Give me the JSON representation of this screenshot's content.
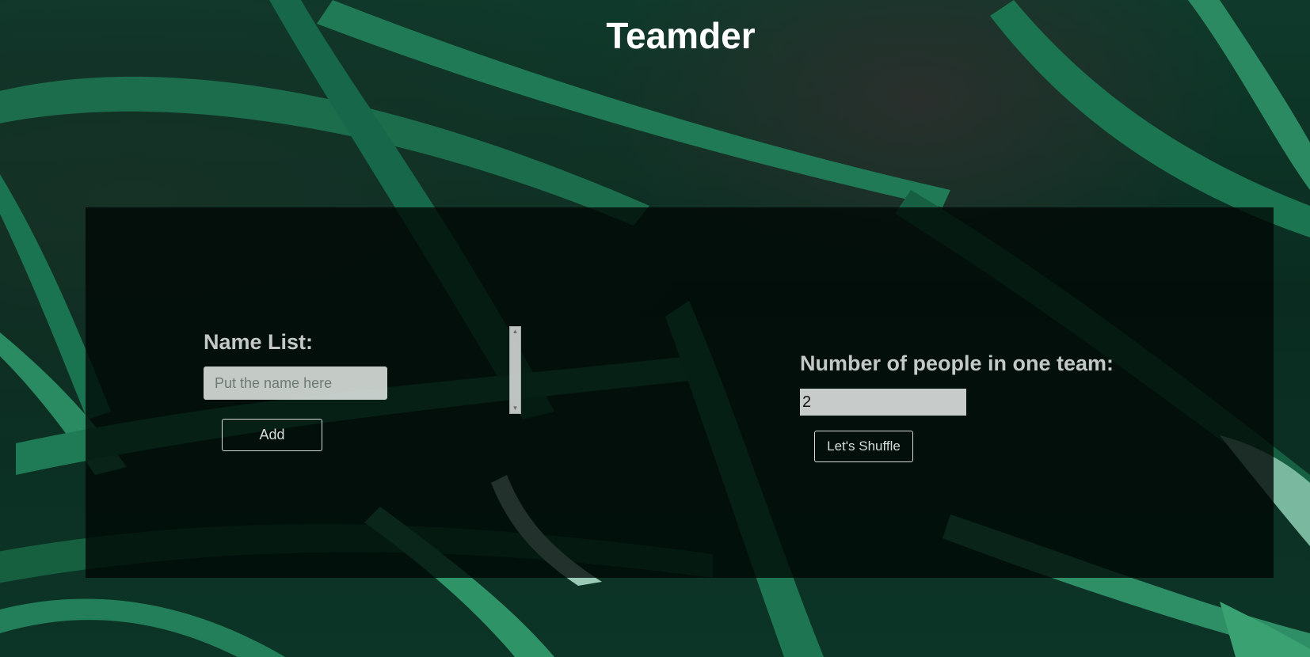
{
  "app": {
    "title": "Teamder"
  },
  "name_list": {
    "label": "Name List:",
    "input_placeholder": "Put the name here",
    "input_value": "",
    "add_button_label": "Add",
    "list_items": []
  },
  "team": {
    "label": "Number of people in one team:",
    "size_value": "2",
    "shuffle_button_label": "Let's Shuffle"
  },
  "icons": {
    "scroll_up": "scroll-up-arrow-icon",
    "scroll_down": "scroll-down-arrow-icon"
  },
  "colors": {
    "title_text": "#ffffff",
    "label_text": "#c4c8c6",
    "panel_bg": "rgba(0,6,4,0.78)",
    "background_foliage": "#0f5a3e"
  }
}
